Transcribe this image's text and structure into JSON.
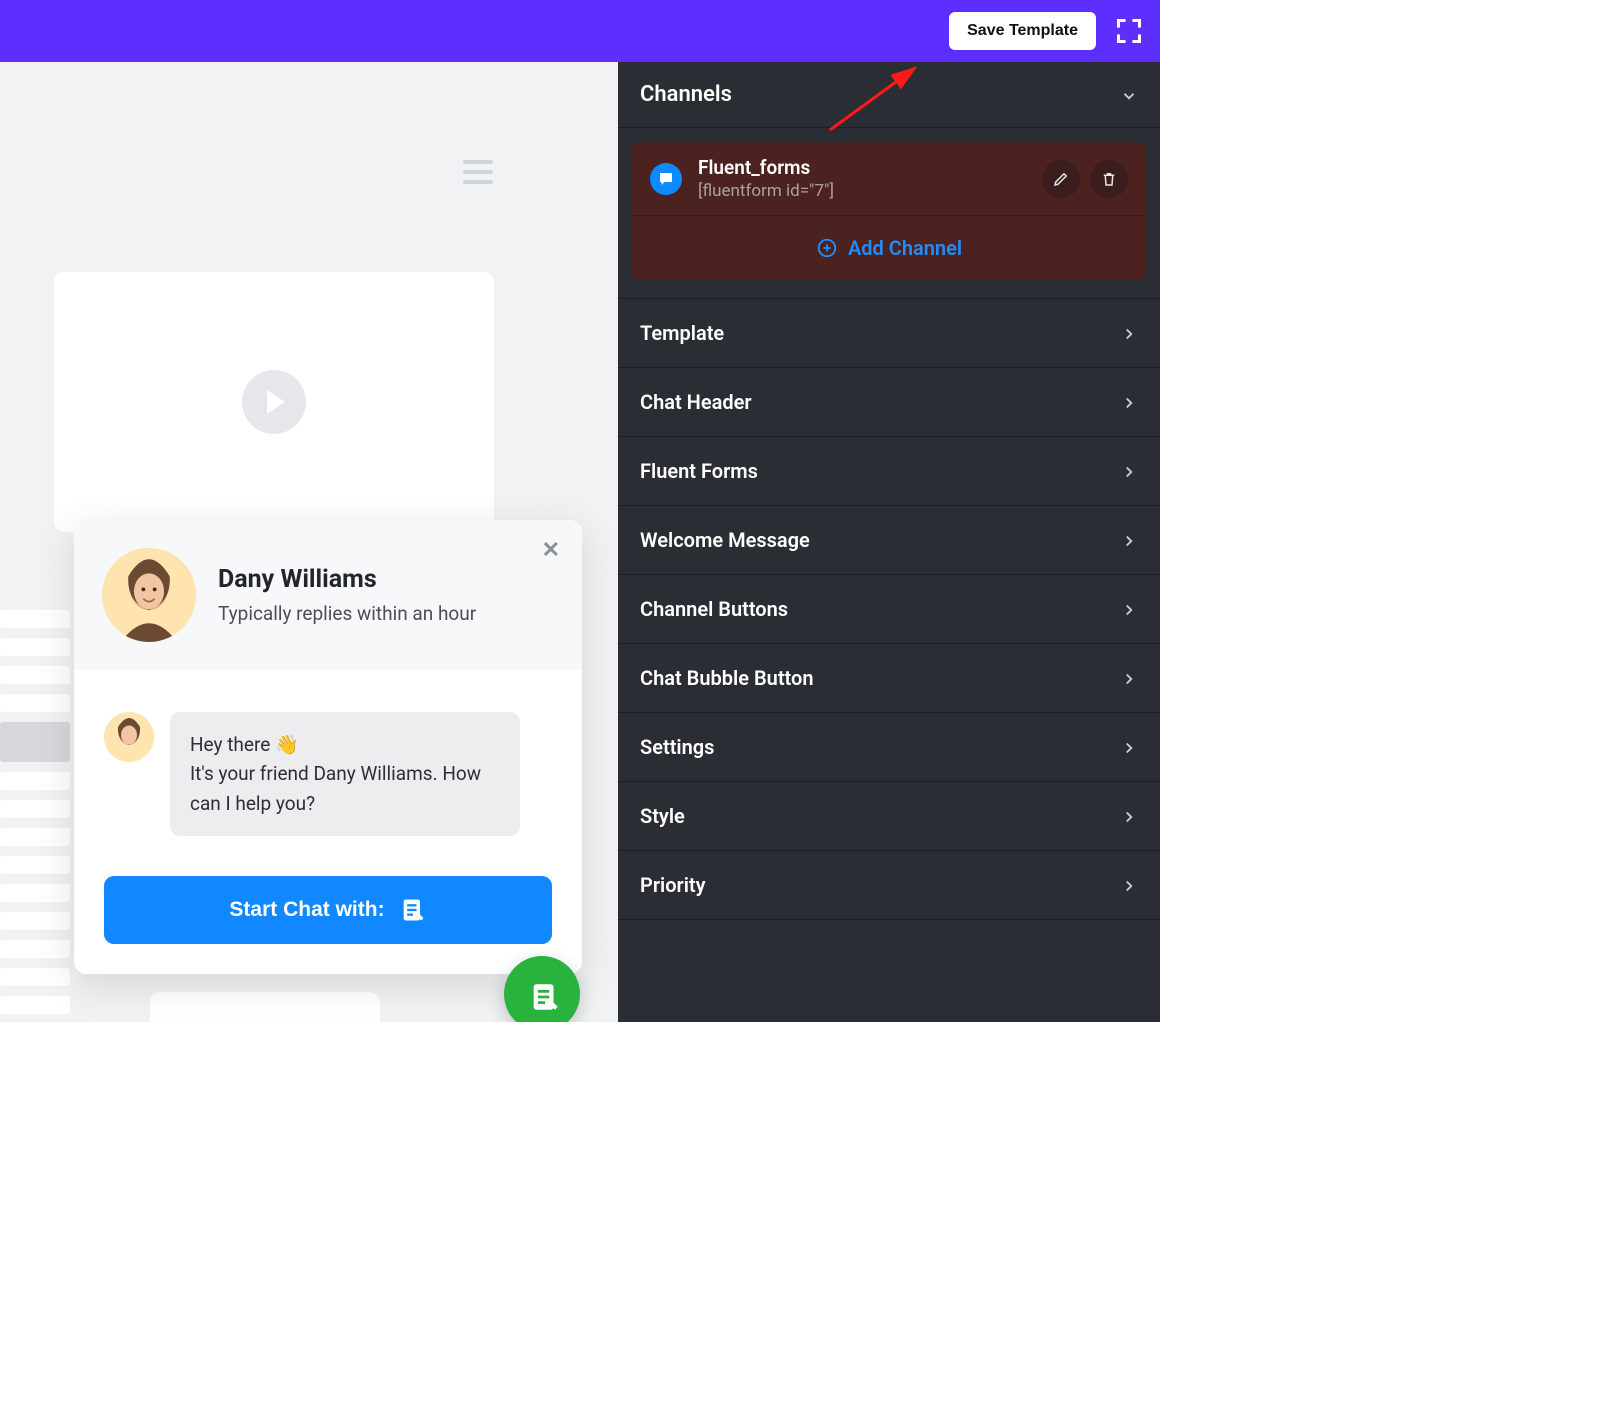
{
  "topbar": {
    "save_label": "Save Template"
  },
  "preview": {
    "chat": {
      "name": "Dany Williams",
      "subtitle": "Typically replies within an hour",
      "message": "Hey there 👋\nIt's your friend Dany Williams. How can I help you?",
      "start_label": "Start Chat with:"
    }
  },
  "config": {
    "channels_title": "Channels",
    "channel": {
      "title": "Fluent_forms",
      "subtitle": "[fluentform id=\"7\"]"
    },
    "add_channel_label": "Add Channel",
    "sections": [
      "Template",
      "Chat Header",
      "Fluent Forms",
      "Welcome Message",
      "Channel Buttons",
      "Chat Bubble Button",
      "Settings",
      "Style",
      "Priority"
    ]
  },
  "colors": {
    "brand": "#5e2eff",
    "accent_blue": "#1188ff",
    "fab_green": "#27b33d",
    "link_blue": "#1f8cff",
    "panel_dark": "#2a2d33",
    "channel_bg": "#4c2221"
  }
}
